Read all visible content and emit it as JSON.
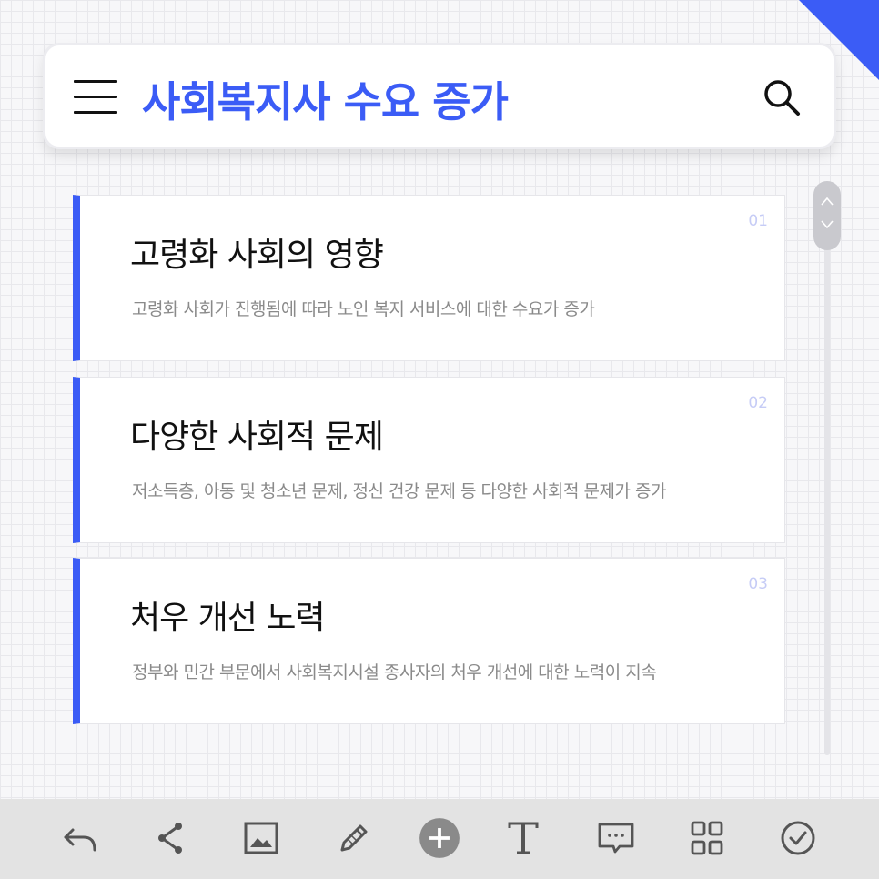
{
  "header": {
    "title": "사회복지사 수요 증가",
    "menu_icon": "hamburger-menu-icon",
    "search_icon": "search-icon"
  },
  "colors": {
    "accent": "#3b5cf6",
    "card_number": "#c6ccf6",
    "description": "#8a8a8a",
    "toolbar_bg": "#e3e3e3"
  },
  "cards": [
    {
      "number": "01",
      "title": "고령화 사회의 영향",
      "description": "고령화 사회가 진행됨에 따라 노인 복지 서비스에 대한 수요가 증가"
    },
    {
      "number": "02",
      "title": "다양한 사회적 문제",
      "description": "저소득층, 아동 및 청소년 문제, 정신 건강 문제 등 다양한 사회적 문제가 증가"
    },
    {
      "number": "03",
      "title": "처우 개선 노력",
      "description": "정부와 민간 부문에서 사회복지시설 종사자의 처우 개선에 대한 노력이 지속"
    }
  ],
  "toolbar": {
    "icons": [
      "undo-icon",
      "share-icon",
      "image-icon",
      "pencil-icon",
      "add-icon",
      "text-icon",
      "comment-icon",
      "grid-icon",
      "check-icon"
    ]
  }
}
